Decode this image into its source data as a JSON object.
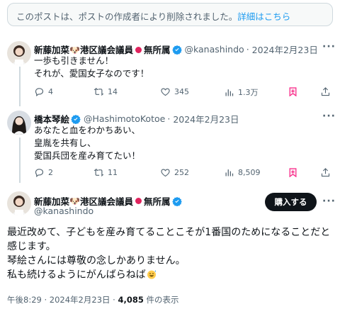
{
  "deleted_notice": {
    "text": "このポストは、ポストの作成者により削除されました。",
    "link": "詳細はこちら"
  },
  "tweets": [
    {
      "name": "新藤加菜",
      "name_suffix": "港区議会議員",
      "name_tail": "無所属",
      "handle": "@kanashindo",
      "date": "2024年2月23日",
      "lines": [
        "一歩も引きません！",
        "それが、愛国女子なのです！"
      ],
      "replies": "4",
      "retweets": "14",
      "likes": "345",
      "views": "1.3万"
    },
    {
      "name": "橋本琴絵",
      "handle": "@HashimotoKotoe",
      "date": "2024年2月23日",
      "lines": [
        "あなたと血をわかちあい、",
        "皇胤を共有し、",
        "愛国兵団を産み育てたい！"
      ],
      "replies": "2",
      "retweets": "11",
      "likes": "252",
      "views": "8,509"
    }
  ],
  "main_post": {
    "name": "新藤加菜",
    "name_suffix": "港区議会議員",
    "name_tail": "無所属",
    "handle": "@kanashindo",
    "buy_label": "購入する",
    "lines": [
      "最近改めて、子どもを産み育てることこそが1番国のためになることだと",
      "感じます。",
      "琴絵さんには尊敬の念しかありません。",
      "私も続けるようにがんばらねば"
    ],
    "time": "午後8:29 · 2024年2月23日 · ",
    "views_count": "4,085",
    "views_label": " 件の表示"
  },
  "colors": {
    "accent": "#1d9bf0",
    "text": "#0f1419",
    "muted": "#536471",
    "border": "#cfd9de",
    "bookmark": "#f91880"
  },
  "icons": [
    "reply-icon",
    "retweet-icon",
    "like-icon",
    "views-icon",
    "bookmark-icon",
    "share-icon",
    "verified-icon",
    "more-icon",
    "dog-emoji-icon",
    "japan-flag-icon",
    "sweat-smile-emoji-icon"
  ]
}
